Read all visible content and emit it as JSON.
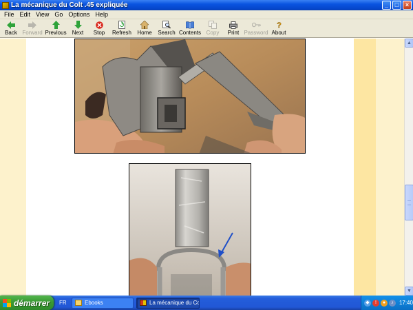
{
  "window": {
    "title": "La mécanique du Colt .45 expliquée",
    "buttons": [
      "minimize",
      "maximize",
      "close"
    ]
  },
  "menu": [
    "File",
    "Edit",
    "View",
    "Go",
    "Options",
    "Help"
  ],
  "toolbar": [
    {
      "label": "Back",
      "icon": "back-arrow-icon",
      "enabled": true
    },
    {
      "label": "Forward",
      "icon": "forward-arrow-icon",
      "enabled": false
    },
    {
      "label": "Previous",
      "icon": "up-arrow-icon",
      "enabled": true
    },
    {
      "label": "Next",
      "icon": "down-arrow-icon",
      "enabled": true
    },
    {
      "label": "Stop",
      "icon": "stop-icon",
      "enabled": true
    },
    {
      "label": "Refresh",
      "icon": "refresh-icon",
      "enabled": true
    },
    {
      "label": "Home",
      "icon": "home-icon",
      "enabled": true
    },
    {
      "label": "Search",
      "icon": "search-icon",
      "enabled": true
    },
    {
      "label": "Contents",
      "icon": "contents-icon",
      "enabled": true
    },
    {
      "label": "Copy",
      "icon": "copy-icon",
      "enabled": false
    },
    {
      "label": "Print",
      "icon": "print-icon",
      "enabled": true
    },
    {
      "label": "Password",
      "icon": "key-icon",
      "enabled": false
    },
    {
      "label": "About",
      "icon": "about-icon",
      "enabled": true
    }
  ],
  "content": {
    "colors": {
      "band_light": "#fdf2cc",
      "band_dark": "#fde6a2",
      "background": "#ffffff"
    },
    "images": [
      {
        "subject": "revolver mechanism with spring tool"
      },
      {
        "subject": "flat spring held in pliers with blue arrow"
      }
    ]
  },
  "taskbar": {
    "start_label": "démarrer",
    "language": "FR",
    "tasks": [
      {
        "label": "Ebooks",
        "icon": "folder-icon",
        "active": false
      },
      {
        "label": "La mécanique du Colt...",
        "icon": "ebook-icon",
        "active": true
      }
    ],
    "clock": "17:40"
  }
}
